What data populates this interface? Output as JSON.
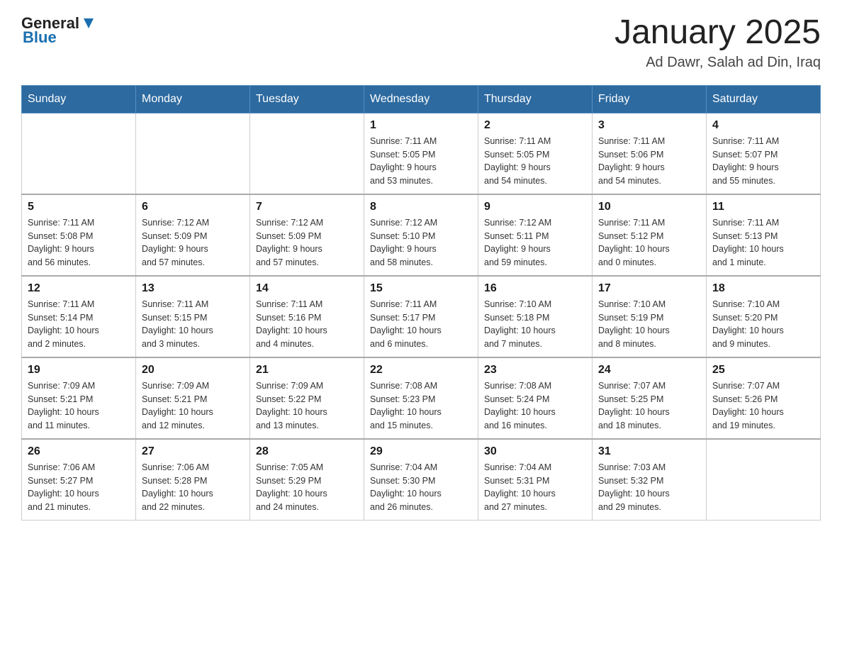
{
  "header": {
    "logo_general": "General",
    "logo_blue": "Blue",
    "title": "January 2025",
    "subtitle": "Ad Dawr, Salah ad Din, Iraq"
  },
  "days_of_week": [
    "Sunday",
    "Monday",
    "Tuesday",
    "Wednesday",
    "Thursday",
    "Friday",
    "Saturday"
  ],
  "weeks": [
    [
      {
        "day": "",
        "info": ""
      },
      {
        "day": "",
        "info": ""
      },
      {
        "day": "",
        "info": ""
      },
      {
        "day": "1",
        "info": "Sunrise: 7:11 AM\nSunset: 5:05 PM\nDaylight: 9 hours\nand 53 minutes."
      },
      {
        "day": "2",
        "info": "Sunrise: 7:11 AM\nSunset: 5:05 PM\nDaylight: 9 hours\nand 54 minutes."
      },
      {
        "day": "3",
        "info": "Sunrise: 7:11 AM\nSunset: 5:06 PM\nDaylight: 9 hours\nand 54 minutes."
      },
      {
        "day": "4",
        "info": "Sunrise: 7:11 AM\nSunset: 5:07 PM\nDaylight: 9 hours\nand 55 minutes."
      }
    ],
    [
      {
        "day": "5",
        "info": "Sunrise: 7:11 AM\nSunset: 5:08 PM\nDaylight: 9 hours\nand 56 minutes."
      },
      {
        "day": "6",
        "info": "Sunrise: 7:12 AM\nSunset: 5:09 PM\nDaylight: 9 hours\nand 57 minutes."
      },
      {
        "day": "7",
        "info": "Sunrise: 7:12 AM\nSunset: 5:09 PM\nDaylight: 9 hours\nand 57 minutes."
      },
      {
        "day": "8",
        "info": "Sunrise: 7:12 AM\nSunset: 5:10 PM\nDaylight: 9 hours\nand 58 minutes."
      },
      {
        "day": "9",
        "info": "Sunrise: 7:12 AM\nSunset: 5:11 PM\nDaylight: 9 hours\nand 59 minutes."
      },
      {
        "day": "10",
        "info": "Sunrise: 7:11 AM\nSunset: 5:12 PM\nDaylight: 10 hours\nand 0 minutes."
      },
      {
        "day": "11",
        "info": "Sunrise: 7:11 AM\nSunset: 5:13 PM\nDaylight: 10 hours\nand 1 minute."
      }
    ],
    [
      {
        "day": "12",
        "info": "Sunrise: 7:11 AM\nSunset: 5:14 PM\nDaylight: 10 hours\nand 2 minutes."
      },
      {
        "day": "13",
        "info": "Sunrise: 7:11 AM\nSunset: 5:15 PM\nDaylight: 10 hours\nand 3 minutes."
      },
      {
        "day": "14",
        "info": "Sunrise: 7:11 AM\nSunset: 5:16 PM\nDaylight: 10 hours\nand 4 minutes."
      },
      {
        "day": "15",
        "info": "Sunrise: 7:11 AM\nSunset: 5:17 PM\nDaylight: 10 hours\nand 6 minutes."
      },
      {
        "day": "16",
        "info": "Sunrise: 7:10 AM\nSunset: 5:18 PM\nDaylight: 10 hours\nand 7 minutes."
      },
      {
        "day": "17",
        "info": "Sunrise: 7:10 AM\nSunset: 5:19 PM\nDaylight: 10 hours\nand 8 minutes."
      },
      {
        "day": "18",
        "info": "Sunrise: 7:10 AM\nSunset: 5:20 PM\nDaylight: 10 hours\nand 9 minutes."
      }
    ],
    [
      {
        "day": "19",
        "info": "Sunrise: 7:09 AM\nSunset: 5:21 PM\nDaylight: 10 hours\nand 11 minutes."
      },
      {
        "day": "20",
        "info": "Sunrise: 7:09 AM\nSunset: 5:21 PM\nDaylight: 10 hours\nand 12 minutes."
      },
      {
        "day": "21",
        "info": "Sunrise: 7:09 AM\nSunset: 5:22 PM\nDaylight: 10 hours\nand 13 minutes."
      },
      {
        "day": "22",
        "info": "Sunrise: 7:08 AM\nSunset: 5:23 PM\nDaylight: 10 hours\nand 15 minutes."
      },
      {
        "day": "23",
        "info": "Sunrise: 7:08 AM\nSunset: 5:24 PM\nDaylight: 10 hours\nand 16 minutes."
      },
      {
        "day": "24",
        "info": "Sunrise: 7:07 AM\nSunset: 5:25 PM\nDaylight: 10 hours\nand 18 minutes."
      },
      {
        "day": "25",
        "info": "Sunrise: 7:07 AM\nSunset: 5:26 PM\nDaylight: 10 hours\nand 19 minutes."
      }
    ],
    [
      {
        "day": "26",
        "info": "Sunrise: 7:06 AM\nSunset: 5:27 PM\nDaylight: 10 hours\nand 21 minutes."
      },
      {
        "day": "27",
        "info": "Sunrise: 7:06 AM\nSunset: 5:28 PM\nDaylight: 10 hours\nand 22 minutes."
      },
      {
        "day": "28",
        "info": "Sunrise: 7:05 AM\nSunset: 5:29 PM\nDaylight: 10 hours\nand 24 minutes."
      },
      {
        "day": "29",
        "info": "Sunrise: 7:04 AM\nSunset: 5:30 PM\nDaylight: 10 hours\nand 26 minutes."
      },
      {
        "day": "30",
        "info": "Sunrise: 7:04 AM\nSunset: 5:31 PM\nDaylight: 10 hours\nand 27 minutes."
      },
      {
        "day": "31",
        "info": "Sunrise: 7:03 AM\nSunset: 5:32 PM\nDaylight: 10 hours\nand 29 minutes."
      },
      {
        "day": "",
        "info": ""
      }
    ]
  ]
}
